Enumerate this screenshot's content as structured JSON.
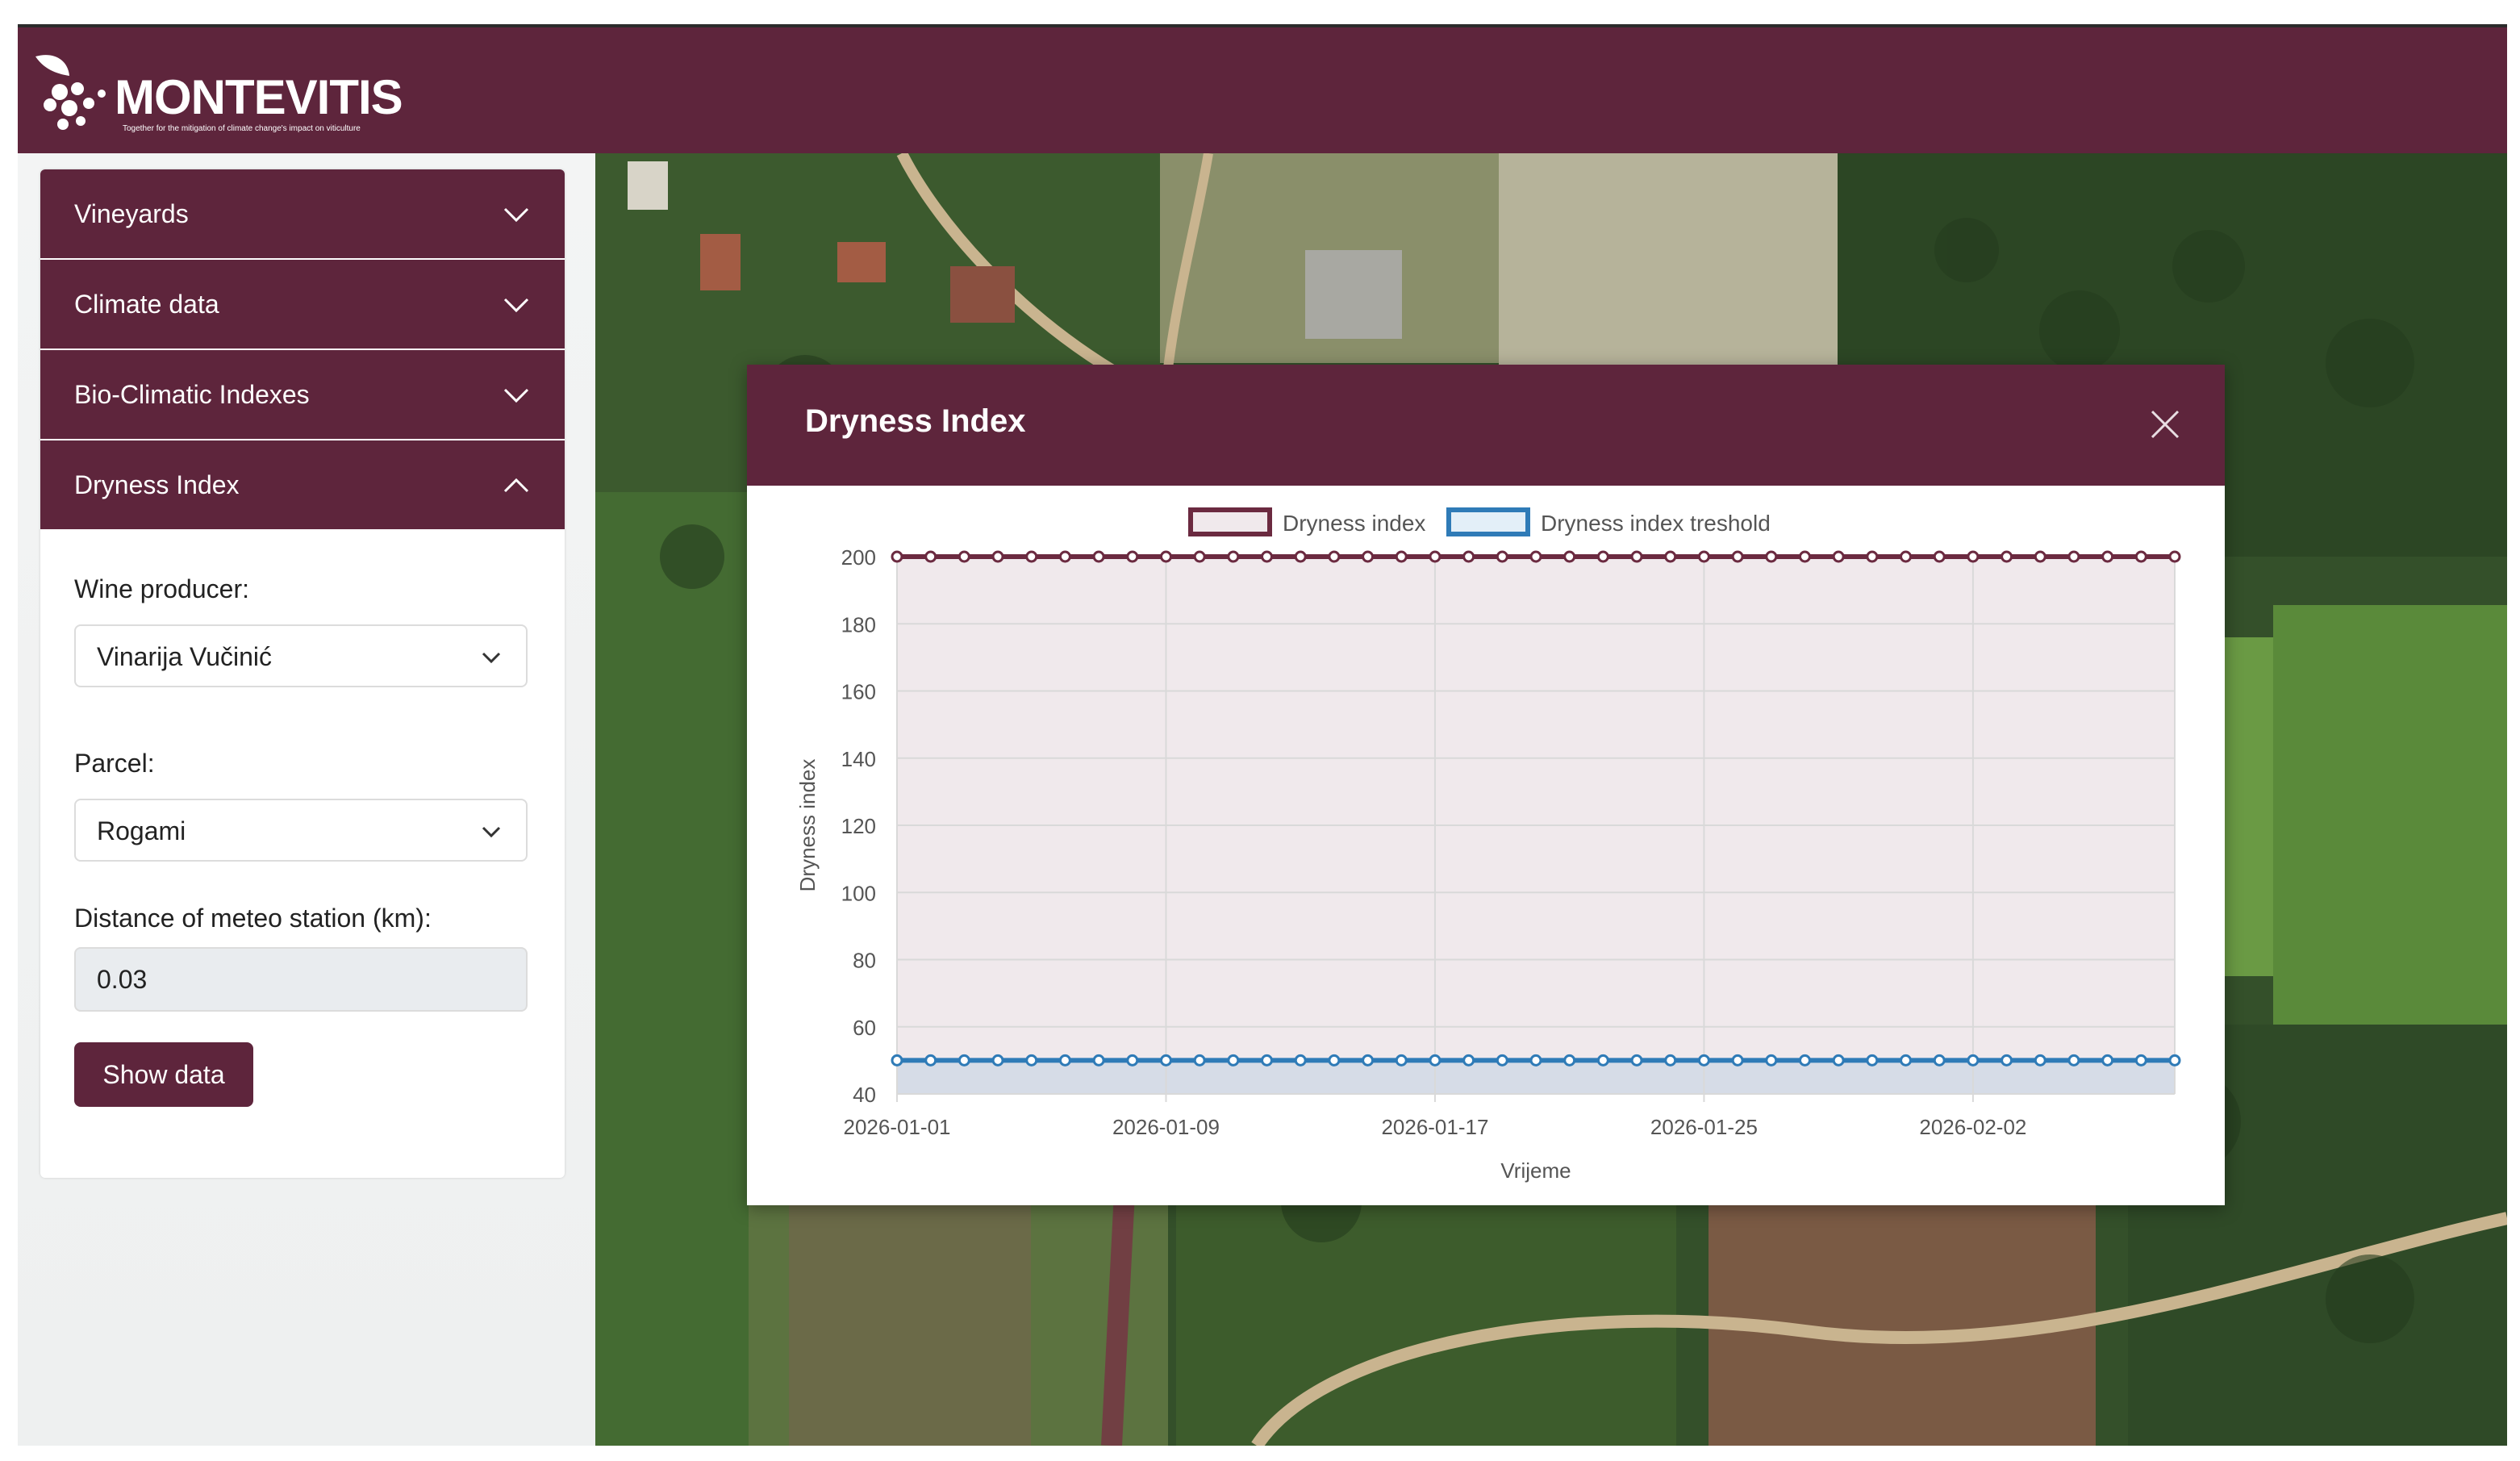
{
  "brand": {
    "name": "MONTEVITIS",
    "tagline": "Together for the mitigation of climate change's impact on viticulture",
    "color": "#5e253c"
  },
  "sidebar": {
    "sections": [
      {
        "label": "Vineyards",
        "expanded": false
      },
      {
        "label": "Climate data",
        "expanded": false
      },
      {
        "label": "Bio-Climatic Indexes",
        "expanded": false
      },
      {
        "label": "Dryness Index",
        "expanded": true
      }
    ],
    "form": {
      "producer_label": "Wine producer:",
      "producer_value": "Vinarija Vučinić",
      "parcel_label": "Parcel:",
      "parcel_value": "Rogami",
      "distance_label": "Distance of meteo station (km):",
      "distance_value": "0.03",
      "submit_label": "Show data"
    }
  },
  "modal": {
    "title": "Dryness Index",
    "close_icon": "close-icon"
  },
  "chart_data": {
    "type": "line",
    "title": "",
    "xlabel": "Vrijeme",
    "ylabel": "Dryness index",
    "ylim": [
      40,
      200
    ],
    "yticks": [
      40,
      60,
      80,
      100,
      120,
      140,
      160,
      180,
      200
    ],
    "x_start": "2026-01-01",
    "x_end": "2026-02-08",
    "xticks": [
      "2026-01-01",
      "2026-01-09",
      "2026-01-17",
      "2026-01-25",
      "2026-02-02"
    ],
    "grid": true,
    "legend_position": "top",
    "series": [
      {
        "name": "Dryness index",
        "color": "#6b2a40",
        "fill": "rgba(107,42,64,0.10)",
        "constant": 200,
        "points": 39
      },
      {
        "name": "Dryness index treshold",
        "color": "#2f7bb7",
        "fill": "rgba(70,150,210,0.15)",
        "constant": 50,
        "points": 39
      }
    ]
  }
}
